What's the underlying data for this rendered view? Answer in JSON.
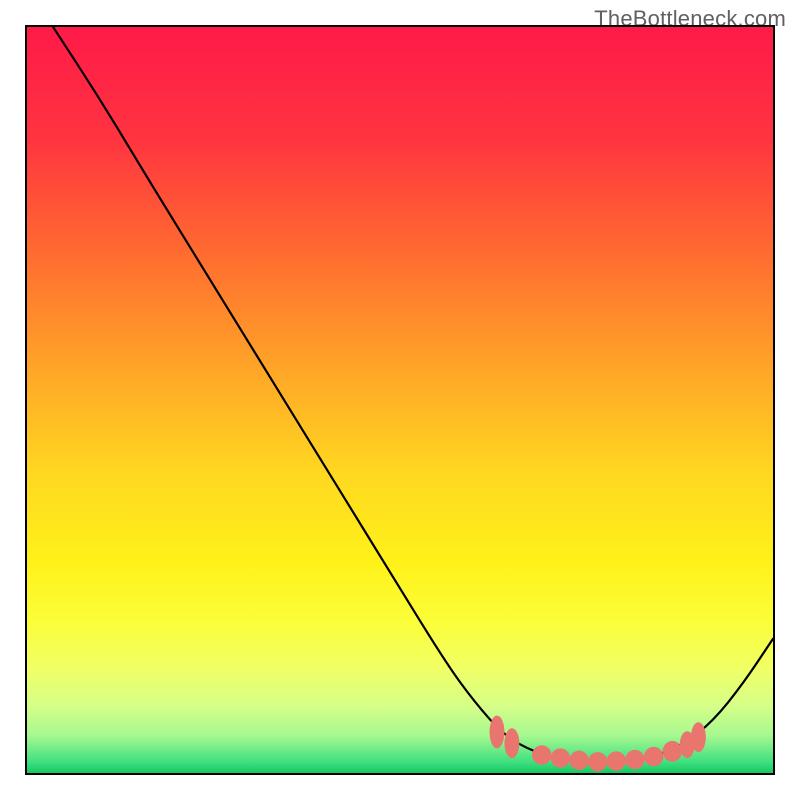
{
  "watermark": "TheBottleneck.com",
  "chart_data": {
    "type": "line",
    "title": "",
    "xlabel": "",
    "ylabel": "",
    "xlim": [
      0,
      100
    ],
    "ylim": [
      0,
      100
    ],
    "grid": false,
    "legend": false,
    "gradient_stops": [
      {
        "offset": 0.0,
        "color": "#ff1a48"
      },
      {
        "offset": 0.15,
        "color": "#ff3440"
      },
      {
        "offset": 0.3,
        "color": "#ff6a30"
      },
      {
        "offset": 0.45,
        "color": "#ffa228"
      },
      {
        "offset": 0.6,
        "color": "#ffd820"
      },
      {
        "offset": 0.72,
        "color": "#fff21a"
      },
      {
        "offset": 0.8,
        "color": "#fbfe3a"
      },
      {
        "offset": 0.86,
        "color": "#f0ff66"
      },
      {
        "offset": 0.91,
        "color": "#d6ff88"
      },
      {
        "offset": 0.95,
        "color": "#a6f890"
      },
      {
        "offset": 0.985,
        "color": "#40e080"
      },
      {
        "offset": 1.0,
        "color": "#14c864"
      }
    ],
    "series": [
      {
        "name": "bottleneck-curve",
        "color": "#000000",
        "points": [
          {
            "x": 3.5,
            "y": 100.0
          },
          {
            "x": 10.0,
            "y": 90.0
          },
          {
            "x": 16.0,
            "y": 80.0
          },
          {
            "x": 24.0,
            "y": 67.0
          },
          {
            "x": 32.0,
            "y": 54.0
          },
          {
            "x": 40.0,
            "y": 41.0
          },
          {
            "x": 48.0,
            "y": 28.0
          },
          {
            "x": 56.0,
            "y": 15.0
          },
          {
            "x": 60.0,
            "y": 9.5
          },
          {
            "x": 64.0,
            "y": 5.0
          },
          {
            "x": 68.0,
            "y": 2.8
          },
          {
            "x": 72.0,
            "y": 1.8
          },
          {
            "x": 76.0,
            "y": 1.5
          },
          {
            "x": 80.0,
            "y": 1.6
          },
          {
            "x": 84.0,
            "y": 2.2
          },
          {
            "x": 88.0,
            "y": 3.8
          },
          {
            "x": 92.0,
            "y": 7.0
          },
          {
            "x": 96.0,
            "y": 12.0
          },
          {
            "x": 100.0,
            "y": 18.0
          }
        ]
      }
    ],
    "markers": {
      "name": "highlight-dots",
      "color": "#e8766f",
      "points": [
        {
          "x": 63.0,
          "y": 5.5,
          "rx": 1.0,
          "ry": 2.2
        },
        {
          "x": 65.0,
          "y": 4.0,
          "rx": 1.0,
          "ry": 2.0
        },
        {
          "x": 69.0,
          "y": 2.4,
          "rx": 1.3,
          "ry": 1.3
        },
        {
          "x": 71.5,
          "y": 2.0,
          "rx": 1.3,
          "ry": 1.3
        },
        {
          "x": 74.0,
          "y": 1.7,
          "rx": 1.3,
          "ry": 1.3
        },
        {
          "x": 76.5,
          "y": 1.5,
          "rx": 1.3,
          "ry": 1.3
        },
        {
          "x": 79.0,
          "y": 1.6,
          "rx": 1.3,
          "ry": 1.3
        },
        {
          "x": 81.5,
          "y": 1.8,
          "rx": 1.3,
          "ry": 1.3
        },
        {
          "x": 84.0,
          "y": 2.2,
          "rx": 1.3,
          "ry": 1.3
        },
        {
          "x": 86.5,
          "y": 2.9,
          "rx": 1.3,
          "ry": 1.4
        },
        {
          "x": 88.5,
          "y": 3.8,
          "rx": 1.0,
          "ry": 1.8
        },
        {
          "x": 90.0,
          "y": 4.8,
          "rx": 1.0,
          "ry": 2.0
        }
      ]
    }
  }
}
